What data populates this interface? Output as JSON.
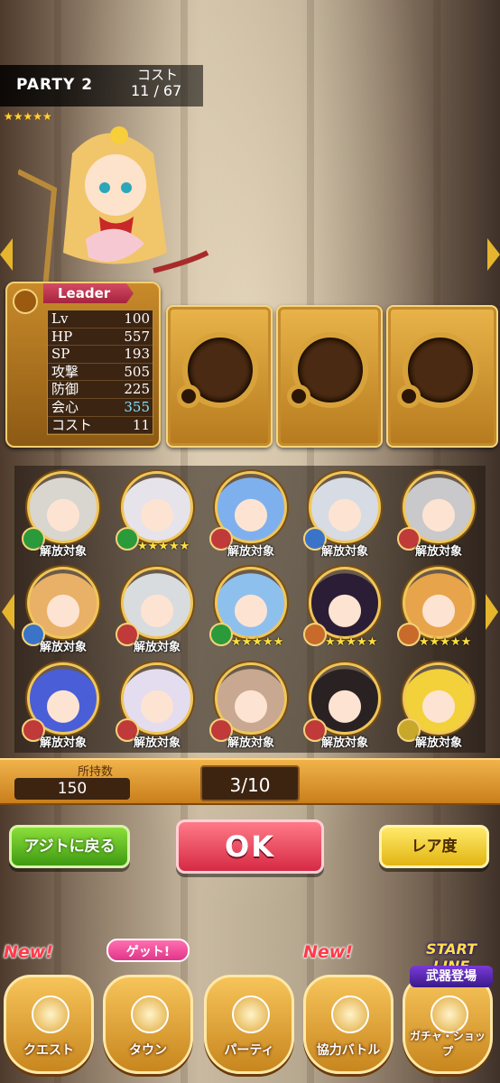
{
  "header": {
    "party": "PARTY 2",
    "cost_label": "コスト",
    "cost_value": "11 / 67",
    "stars": "★★★★★"
  },
  "leader": {
    "tag": "Leader",
    "stats": [
      {
        "k": "Lv",
        "v": "100"
      },
      {
        "k": "HP",
        "v": "557"
      },
      {
        "k": "SP",
        "v": "193"
      },
      {
        "k": "攻撃",
        "v": "505"
      },
      {
        "k": "防御",
        "v": "225"
      },
      {
        "k": "会心",
        "v": "355",
        "highlight": true
      },
      {
        "k": "コスト",
        "v": "11"
      }
    ]
  },
  "units": [
    {
      "label": "解放対象",
      "elem": "#2a9a3a",
      "hair": "#d9d6d0"
    },
    {
      "label": "★★★★★",
      "elem": "#2a9a3a",
      "hair": "#e6e3ea",
      "stars": true
    },
    {
      "label": "解放対象",
      "elem": "#c03a3a",
      "hair": "#7fb0ee"
    },
    {
      "label": "解放対象",
      "elem": "#3a74c8",
      "hair": "#d7dbe3"
    },
    {
      "label": "解放対象",
      "elem": "#c03a3a",
      "hair": "#c9c9cc"
    },
    {
      "label": "解放対象",
      "elem": "#3a74c8",
      "hair": "#e9b067"
    },
    {
      "label": "解放対象",
      "elem": "#c03a3a",
      "hair": "#d9dcde"
    },
    {
      "label": "★★★★★",
      "elem": "#2a9a3a",
      "hair": "#8ec0ee",
      "stars": true
    },
    {
      "label": "★★★★★",
      "elem": "#c86a2a",
      "hair": "#2a1d35",
      "stars": true
    },
    {
      "label": "★★★★★",
      "elem": "#c86a2a",
      "hair": "#e8a44a",
      "stars": true
    },
    {
      "label": "解放対象",
      "elem": "#c03a3a",
      "hair": "#4a5ed8"
    },
    {
      "label": "解放対象",
      "elem": "#c03a3a",
      "hair": "#e4dcef"
    },
    {
      "label": "解放対象",
      "elem": "#c03a3a",
      "hair": "#c8a890"
    },
    {
      "label": "解放対象",
      "elem": "#c03a3a",
      "hair": "#2a2222"
    },
    {
      "label": "解放対象",
      "elem": "#c8a82a",
      "hair": "#f2d13a"
    }
  ],
  "bottom": {
    "own_label": "所持数",
    "own_value": "150",
    "page": "3/10"
  },
  "buttons": {
    "back": "アジトに戻る",
    "ok": "OK",
    "rarity": "レア度"
  },
  "nav": {
    "quest": "クエスト",
    "town": "タウン",
    "party": "パーティ",
    "coop": "協力バトル",
    "gacha": "ガチャ・ショップ",
    "new": "New!",
    "get": "ゲット!",
    "startline": "START LINE",
    "weapon": "武器登場"
  },
  "colors": {
    "gold": "#e6b52e",
    "ok_red": "#d62a44",
    "back_green": "#3f9a12",
    "rare_yellow": "#e2b512"
  }
}
